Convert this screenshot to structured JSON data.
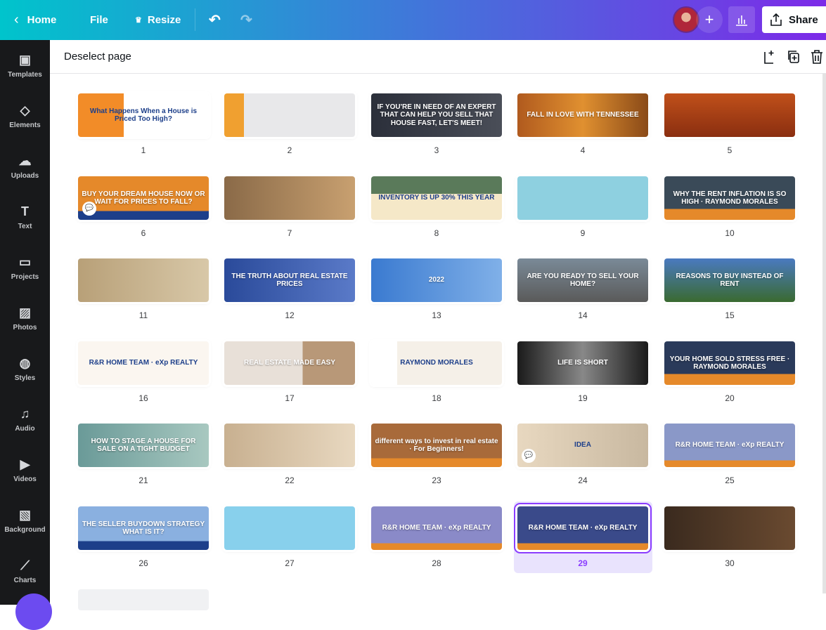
{
  "topbar": {
    "home": "Home",
    "file": "File",
    "resize": "Resize",
    "share": "Share"
  },
  "sidebar": [
    {
      "label": "Templates",
      "icon": "▣"
    },
    {
      "label": "Elements",
      "icon": "◇"
    },
    {
      "label": "Uploads",
      "icon": "☁"
    },
    {
      "label": "Text",
      "icon": "T"
    },
    {
      "label": "Projects",
      "icon": "▭"
    },
    {
      "label": "Photos",
      "icon": "▨"
    },
    {
      "label": "Styles",
      "icon": "◍"
    },
    {
      "label": "Audio",
      "icon": "♫"
    },
    {
      "label": "Videos",
      "icon": "▶"
    },
    {
      "label": "Background",
      "icon": "▧"
    },
    {
      "label": "Charts",
      "icon": "⟋"
    }
  ],
  "toolbar": {
    "deselect": "Deselect page"
  },
  "selected_page": 29,
  "pages": [
    {
      "n": "1",
      "text": "What Happens When a House is Priced Too High?",
      "bg": "linear-gradient(90deg,#f28c28 0 35%,#fff 35%)",
      "dark": true
    },
    {
      "n": "2",
      "text": "",
      "bg": "linear-gradient(90deg,#f0a030 0 15%,#e8e8ea 15%)"
    },
    {
      "n": "3",
      "text": "IF YOU'RE IN NEED OF AN EXPERT THAT CAN HELP YOU SELL THAT HOUSE FAST, LET'S MEET!",
      "bg": "linear-gradient(90deg,#2b2f3a,#4a4e58)"
    },
    {
      "n": "4",
      "text": "FALL IN LOVE WITH TENNESSEE",
      "bg": "linear-gradient(90deg,#b05a1e,#e09030,#8a4a18)"
    },
    {
      "n": "5",
      "text": "",
      "bg": "linear-gradient(180deg,#c0501a,#8a2e10)"
    },
    {
      "n": "6",
      "text": "BUY YOUR DREAM HOUSE NOW OR WAIT FOR PRICES TO FALL?",
      "bg": "linear-gradient(180deg,#e5892a 0 80%,#1d3f8a 80%)",
      "comment": true
    },
    {
      "n": "7",
      "text": "",
      "bg": "linear-gradient(90deg,#8a6a48,#c8a070)"
    },
    {
      "n": "8",
      "text": "INVENTORY IS UP 30% THIS YEAR",
      "bg": "linear-gradient(180deg,#5a7a5a 0 40%,#f5e8c8 40%)",
      "dark": true
    },
    {
      "n": "9",
      "text": "",
      "bg": "#8ed0e0"
    },
    {
      "n": "10",
      "text": "WHY THE RENT INFLATION IS SO HIGH · RAYMOND MORALES",
      "bg": "linear-gradient(180deg,#3a4a58 0 75%,#e5892a 75%)"
    },
    {
      "n": "11",
      "text": "",
      "bg": "linear-gradient(90deg,#b8a078,#d8c8a8)"
    },
    {
      "n": "12",
      "text": "THE TRUTH ABOUT REAL ESTATE PRICES",
      "bg": "linear-gradient(90deg,#2a4a9a,#5a7ac8)"
    },
    {
      "n": "13",
      "text": "2022",
      "bg": "linear-gradient(90deg,#3a7ad0,#80b0e8)"
    },
    {
      "n": "14",
      "text": "ARE YOU READY TO SELL YOUR HOME?",
      "bg": "linear-gradient(180deg,#7a8a98,#5a5a5a)"
    },
    {
      "n": "15",
      "text": "REASONS TO BUY INSTEAD OF RENT",
      "bg": "linear-gradient(180deg,#4a7ac0,#3a6a30)"
    },
    {
      "n": "16",
      "text": "R&R HOME TEAM · eXp REALTY",
      "bg": "#fbf6f0",
      "dark": true
    },
    {
      "n": "17",
      "text": "REAL ESTATE MADE EASY",
      "bg": "linear-gradient(90deg,#e8e0d8 0 60%,#b89878 60%)"
    },
    {
      "n": "18",
      "text": "RAYMOND MORALES",
      "bg": "linear-gradient(90deg,#fff 0 20%,#f5f0e8 20%)",
      "dark": true
    },
    {
      "n": "19",
      "text": "LIFE IS SHORT",
      "bg": "linear-gradient(90deg,#1a1a1a,#888,#1a1a1a)"
    },
    {
      "n": "20",
      "text": "YOUR HOME SOLD STRESS FREE · RAYMOND MORALES",
      "bg": "linear-gradient(180deg,#2a3a5a 0 75%,#e5892a 75%)"
    },
    {
      "n": "21",
      "text": "HOW TO STAGE A HOUSE FOR SALE ON A TIGHT BUDGET",
      "bg": "linear-gradient(90deg,#6a9a98,#a8c8c0)"
    },
    {
      "n": "22",
      "text": "",
      "bg": "linear-gradient(90deg,#c8b090,#e8d8c0)"
    },
    {
      "n": "23",
      "text": "different ways to invest in real estate · For Beginners!",
      "bg": "linear-gradient(180deg,#a86a3a 0 80%,#e5892a 80%)"
    },
    {
      "n": "24",
      "text": "IDEA",
      "bg": "linear-gradient(90deg,#e8d8c0,#c8b8a0)",
      "dark": true,
      "comment": true
    },
    {
      "n": "25",
      "text": "R&R HOME TEAM · eXp REALTY",
      "bg": "linear-gradient(180deg,#8a98c8 0 85%,#e5892a 85%)"
    },
    {
      "n": "26",
      "text": "THE SELLER BUYDOWN STRATEGY WHAT IS IT?",
      "bg": "linear-gradient(180deg,#8ab0e0 0 80%,#1d3f8a 80%)"
    },
    {
      "n": "27",
      "text": "",
      "bg": "#88d0ec"
    },
    {
      "n": "28",
      "text": "R&R HOME TEAM · eXp REALTY",
      "bg": "linear-gradient(180deg,#8a8ac8 0 85%,#e5892a 85%)"
    },
    {
      "n": "29",
      "text": "R&R HOME TEAM · eXp REALTY",
      "bg": "linear-gradient(180deg,#3a4a8a 0 85%,#e5892a 85%)"
    },
    {
      "n": "30",
      "text": "",
      "bg": "linear-gradient(90deg,#3a2a1e,#6a4a30)"
    }
  ]
}
